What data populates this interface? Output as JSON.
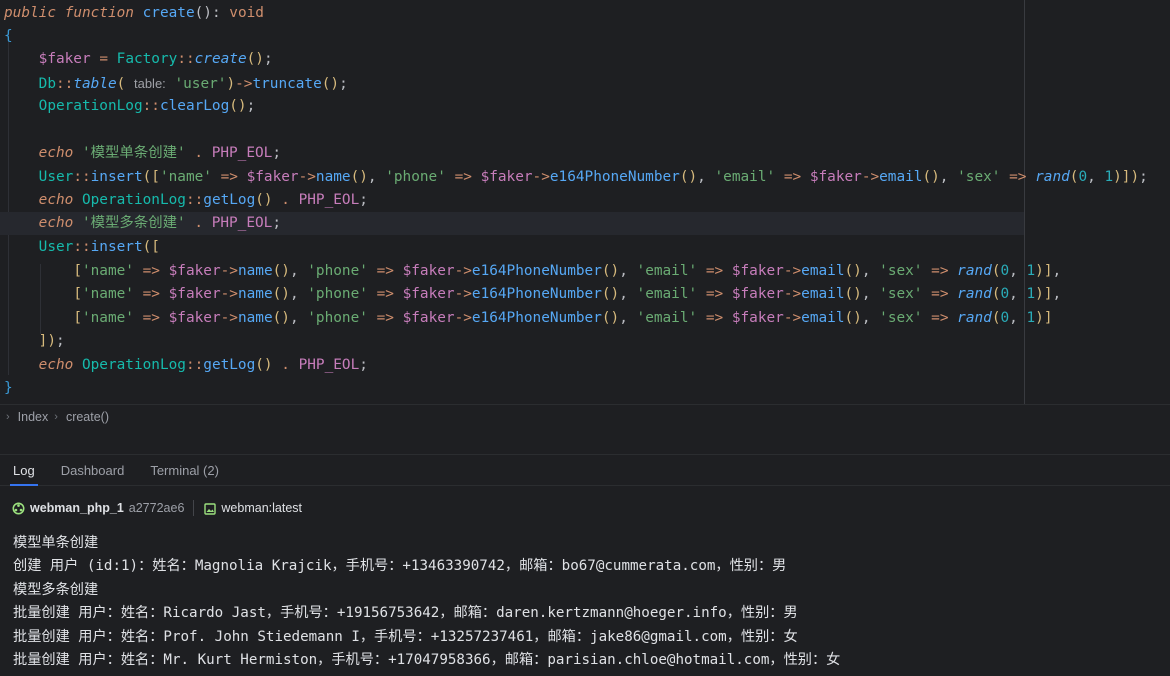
{
  "editor": {
    "code": {
      "kw_public": "public",
      "kw_function": "function",
      "fn_create": "create",
      "kw_void": "void",
      "open_brace": "{",
      "close_brace": "}",
      "var_faker": "$faker",
      "cls_factory": "Factory",
      "m_create": "create",
      "cls_db": "Db",
      "m_table": "table",
      "hint_table": "table:",
      "str_user": "'user'",
      "m_truncate": "truncate",
      "cls_oplog": "OperationLog",
      "m_clearlog": "clearLog",
      "kw_echo": "echo",
      "str_single": "'模型单条创建'",
      "str_multi": "'模型多条创建'",
      "const_eol": "PHP_EOL",
      "cls_user": "User",
      "m_insert": "insert",
      "str_name": "'name'",
      "str_phone": "'phone'",
      "str_email": "'email'",
      "str_sex": "'sex'",
      "m_name": "name",
      "m_phone": "e164PhoneNumber",
      "m_email": "email",
      "fn_rand": "rand",
      "num_0": "0",
      "num_1": "1",
      "m_getlog": "getLog"
    }
  },
  "breadcrumb": {
    "items": [
      "Index",
      "create()"
    ]
  },
  "tool_tabs": [
    "Log",
    "Dashboard",
    "Terminal (2)"
  ],
  "container": {
    "name": "webman_php_1",
    "id": "a2772ae6",
    "image": "webman:latest"
  },
  "log_lines": [
    "模型单条创建",
    "创建 用户 (id:1)：姓名：Magnolia Krajcik，手机号：+13463390742，邮箱：bo67@cummerata.com，性别：男",
    "模型多条创建",
    "批量创建 用户：姓名：Ricardo Jast，手机号：+19156753642，邮箱：daren.kertzmann@hoeger.info，性别：男",
    "批量创建 用户：姓名：Prof. John Stiedemann I，手机号：+13257237461，邮箱：jake86@gmail.com，性别：女",
    "批量创建 用户：姓名：Mr. Kurt Hermiston，手机号：+17047958366，邮箱：parisian.chloe@hotmail.com，性别：女"
  ],
  "colors": {
    "background": "#1e1f22",
    "keyword": "#cf8e6d",
    "function": "#56a8f5",
    "class": "#16baac",
    "variable": "#c77dbb",
    "string": "#6aab73",
    "number": "#2aacb8",
    "active_tab_underline": "#3574f0"
  }
}
